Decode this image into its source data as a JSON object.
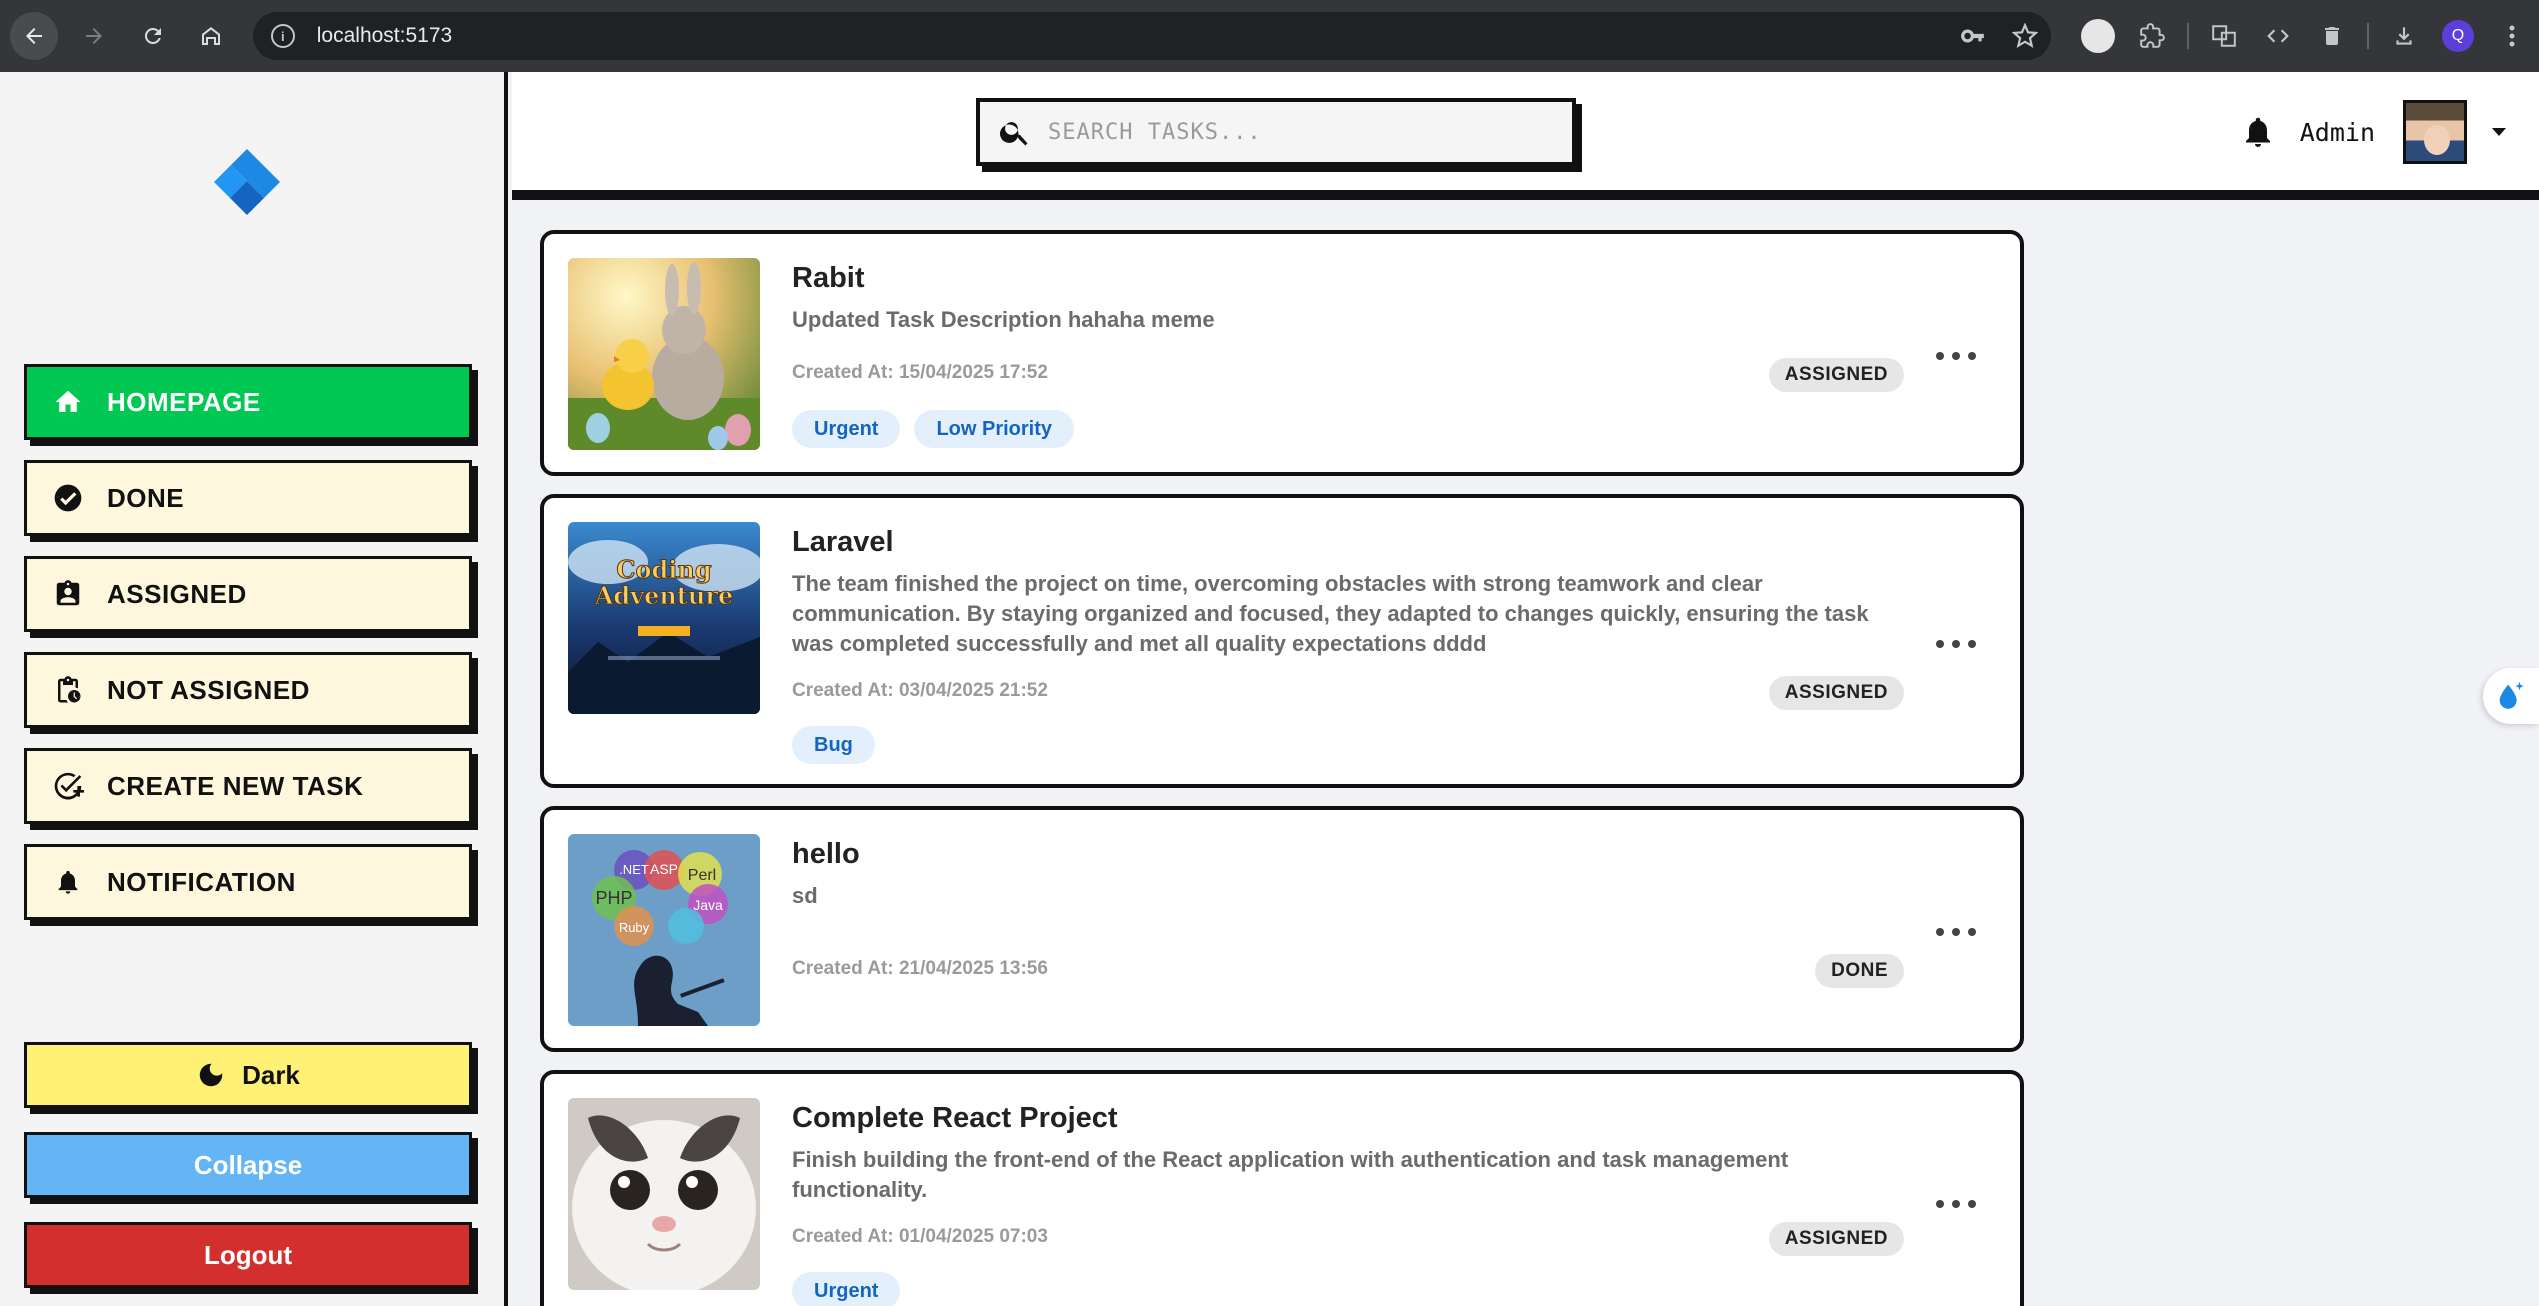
{
  "browser": {
    "url": "localhost:5173",
    "profile_initial": "Q"
  },
  "sidebar": {
    "items": [
      {
        "label": "HOMEPAGE",
        "icon": "home-icon"
      },
      {
        "label": "DONE",
        "icon": "check-circle-icon"
      },
      {
        "label": "ASSIGNED",
        "icon": "assignment-ind-icon"
      },
      {
        "label": "NOT ASSIGNED",
        "icon": "pending-actions-icon"
      },
      {
        "label": "CREATE NEW TASK",
        "icon": "add-task-icon"
      },
      {
        "label": "NOTIFICATION",
        "icon": "bell-icon"
      }
    ],
    "dark_label": "Dark",
    "collapse_label": "Collapse",
    "logout_label": "Logout"
  },
  "header": {
    "search_placeholder": "SEARCH TASKS...",
    "user_name": "Admin"
  },
  "tasks": [
    {
      "title": "Rabit",
      "description": "Updated Task Description hahaha meme",
      "created": "Created At: 15/04/2025 17:52",
      "status": "ASSIGNED",
      "tags": [
        "Urgent",
        "Low Priority"
      ]
    },
    {
      "title": "Laravel",
      "description": "The team finished the project on time, overcoming obstacles with strong teamwork and clear communication. By staying organized and focused, they adapted to changes quickly, ensuring the task was completed successfully and met all quality expectations dddd",
      "created": "Created At: 03/04/2025 21:52",
      "status": "ASSIGNED",
      "tags": [
        "Bug"
      ],
      "thumb_text": [
        "Coding",
        "Adventure"
      ]
    },
    {
      "title": "hello",
      "description": "sd",
      "created": "Created At: 21/04/2025 13:56",
      "status": "DONE",
      "tags": [],
      "thumb_words": [
        ".NET",
        "ASP",
        "Perl",
        "PHP",
        "Java",
        "Ruby"
      ]
    },
    {
      "title": "Complete React Project",
      "description": "Finish building the front-end of the React application with authentication and task management functionality.",
      "created": "Created At: 01/04/2025 07:03",
      "status": "ASSIGNED",
      "tags": [
        "Urgent"
      ]
    }
  ],
  "colors": {
    "accent_green": "#00c853",
    "dark_yellow": "#fff176",
    "collapse_blue": "#64b5f6",
    "logout_red": "#d32f2f",
    "tag_blue": "#1565c0"
  }
}
